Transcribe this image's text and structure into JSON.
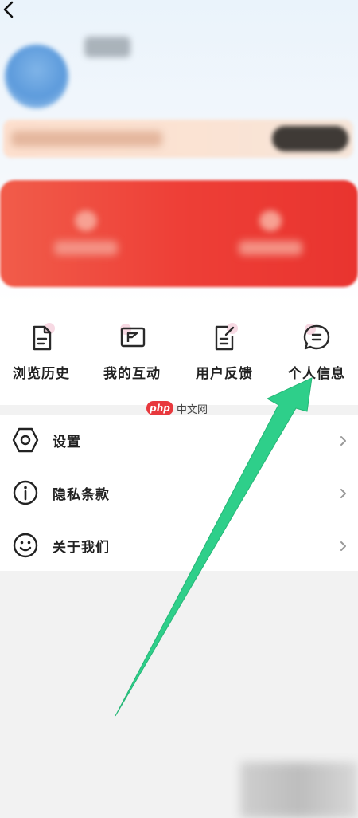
{
  "header": {
    "back_icon": "chevron-left-icon"
  },
  "quick_actions": [
    {
      "label": "浏览历史",
      "icon": "document-icon"
    },
    {
      "label": "我的互动",
      "icon": "message-box-icon"
    },
    {
      "label": "用户反馈",
      "icon": "feedback-edit-icon"
    },
    {
      "label": "个人信息",
      "icon": "chat-bubble-icon"
    }
  ],
  "watermark": {
    "logo": "php",
    "text": "中文网"
  },
  "menu": [
    {
      "label": "设置",
      "icon": "hexagon-settings-icon"
    },
    {
      "label": "隐私条款",
      "icon": "info-circle-icon"
    },
    {
      "label": "关于我们",
      "icon": "smiley-icon"
    }
  ],
  "colors": {
    "accent_red": "#ee3f37",
    "annotation_arrow": "#2ecf8a",
    "background": "#f2f2f2"
  }
}
